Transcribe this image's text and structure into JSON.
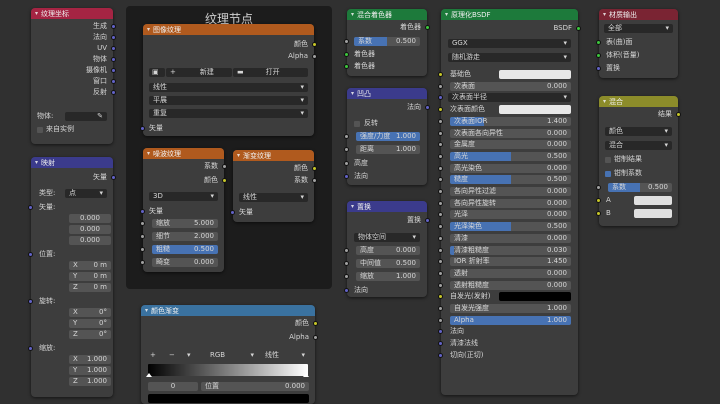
{
  "frame": {
    "title": "纹理节点"
  },
  "texcoord": {
    "title": "纹理坐标",
    "outputs": [
      "生成",
      "法向",
      "UV",
      "物体",
      "摄像机",
      "窗口",
      "反射"
    ],
    "object_label": "物体:",
    "from_instancer": "来自实例"
  },
  "mapping": {
    "title": "映射",
    "output": "矢量",
    "type_label": "类型:",
    "type_value": "点",
    "vector_label": "矢量:",
    "vector": [
      "0.000",
      "0.000",
      "0.000"
    ],
    "location_label": "位置:",
    "location": [
      [
        "X",
        "0 m"
      ],
      [
        "Y",
        "0 m"
      ],
      [
        "Z",
        "0 m"
      ]
    ],
    "rotation_label": "旋转:",
    "rotation": [
      [
        "X",
        "0°"
      ],
      [
        "Y",
        "0°"
      ],
      [
        "Z",
        "0°"
      ]
    ],
    "scale_label": "缩放:",
    "scale": [
      [
        "X",
        "1.000"
      ],
      [
        "Y",
        "1.000"
      ],
      [
        "Z",
        "1.000"
      ]
    ]
  },
  "image": {
    "title": "图像纹理",
    "out_color": "颜色",
    "out_alpha": "Alpha",
    "new_btn": "新建",
    "open_btn": "打开",
    "interp": "线性",
    "proj": "平展",
    "ext": "重复",
    "in_vector": "矢量"
  },
  "noise": {
    "title": "噪波纹理",
    "out_fac": "系数",
    "out_color": "颜色",
    "dim": "3D",
    "in_vector": "矢量",
    "fields": [
      [
        "缩放",
        "5.000"
      ],
      [
        "细节",
        "2.000"
      ],
      [
        "粗糙",
        "0.500"
      ],
      [
        "畸变",
        "0.000"
      ]
    ]
  },
  "gradient": {
    "title": "渐变纹理",
    "out_color": "颜色",
    "out_fac": "系数",
    "type": "线性",
    "in_vector": "矢量"
  },
  "ramp": {
    "title": "颜色渐变",
    "out_color": "颜色",
    "out_alpha": "Alpha",
    "plus": "+",
    "minus": "−",
    "mode": "RGB",
    "interp": "线性",
    "stop_index": "0",
    "pos_label": "位置",
    "pos_value": "0.000"
  },
  "mixshader": {
    "title": "混合着色器",
    "output": "着色器",
    "fac_label": "系数",
    "fac_value": "0.500",
    "in1": "着色器",
    "in2": "着色器"
  },
  "bump": {
    "title": "凹凸",
    "output": "法向",
    "invert": "反转",
    "strength_label": "强度/力度",
    "strength_value": "1.000",
    "distance_label": "距离",
    "distance_value": "1.000",
    "height": "高度",
    "normal": "法向"
  },
  "disp": {
    "title": "置换",
    "output": "置换",
    "space": "物体空间",
    "fields": [
      [
        "高度",
        "0.000"
      ],
      [
        "中间值",
        "0.500"
      ],
      [
        "缩放",
        "1.000"
      ]
    ],
    "normal": "法向"
  },
  "bsdf": {
    "title": "原理化BSDF",
    "output": "BSDF",
    "dist": "GGX",
    "sss_method": "随机游走",
    "rows": [
      {
        "label": "基础色",
        "kind": "swatch"
      },
      {
        "label": "次表面",
        "kind": "bar",
        "value": "0.000",
        "fill": 0
      },
      {
        "label": "次表面半径",
        "kind": "dd"
      },
      {
        "label": "次表面颜色",
        "kind": "swatch"
      },
      {
        "label": "次表面IOR",
        "kind": "bar",
        "value": "1.400",
        "fill": 0.28
      },
      {
        "label": "次表面各向异性",
        "kind": "bar",
        "value": "0.000",
        "fill": 0
      },
      {
        "label": "金属度",
        "kind": "bar",
        "value": "0.000",
        "fill": 0
      },
      {
        "label": "高光",
        "kind": "bar",
        "value": "0.500",
        "fill": 0.5
      },
      {
        "label": "高光染色",
        "kind": "bar",
        "value": "0.000",
        "fill": 0
      },
      {
        "label": "糙度",
        "kind": "bar",
        "value": "0.500",
        "fill": 0.5
      },
      {
        "label": "各向异性过滤",
        "kind": "bar",
        "value": "0.000",
        "fill": 0
      },
      {
        "label": "各向异性旋转",
        "kind": "bar",
        "value": "0.000",
        "fill": 0
      },
      {
        "label": "光泽",
        "kind": "bar",
        "value": "0.000",
        "fill": 0
      },
      {
        "label": "光泽染色",
        "kind": "bar",
        "value": "0.500",
        "fill": 0.5
      },
      {
        "label": "清漆",
        "kind": "bar",
        "value": "0.000",
        "fill": 0
      },
      {
        "label": "清漆粗糙度",
        "kind": "bar",
        "value": "0.030",
        "fill": 0.03
      },
      {
        "label": "IOR 折射率",
        "kind": "bar",
        "value": "1.450",
        "fill": 0
      },
      {
        "label": "透射",
        "kind": "bar",
        "value": "0.000",
        "fill": 0
      },
      {
        "label": "透射粗糙度",
        "kind": "bar",
        "value": "0.000",
        "fill": 0
      },
      {
        "label": "自发光(发射)",
        "kind": "dark"
      },
      {
        "label": "自发光强度",
        "kind": "bar",
        "value": "1.000",
        "fill": 0
      },
      {
        "label": "Alpha",
        "kind": "bar",
        "value": "1.000",
        "fill": 1
      },
      {
        "label": "法向",
        "kind": "socket"
      },
      {
        "label": "清漆法线",
        "kind": "socket"
      },
      {
        "label": "切向(正切)",
        "kind": "socket"
      }
    ]
  },
  "output": {
    "title": "材质输出",
    "target": "全部",
    "inputs": [
      "表(曲)面",
      "体积(音量)",
      "置换"
    ]
  },
  "mix": {
    "title": "混合",
    "output": "结果",
    "data_type": "颜色",
    "blend": "混合",
    "clamp_result": "钳制结果",
    "clamp_factor": "钳制系数",
    "fac_label": "系数",
    "fac_value": "0.500",
    "a": "A",
    "b": "B"
  },
  "colors": {
    "texture_header": "#b05a1e",
    "input_header": "#a52443",
    "shader_header": "#1d7a3b",
    "vector_header": "#3b3b8c",
    "converter_header": "#3a72a0",
    "output_header": "#7a2433",
    "layout_header": "#8c8c2a",
    "accent": "#4772b3"
  }
}
